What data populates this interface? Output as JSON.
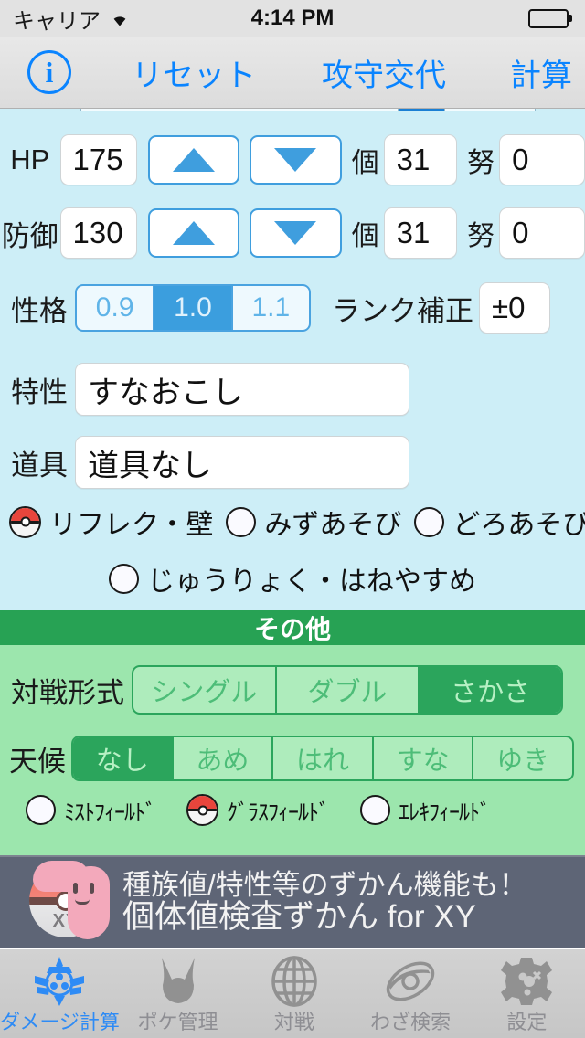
{
  "status_bar": {
    "carrier": "キャリア",
    "wifi_icon": "wifi-icon",
    "time": "4:14 PM",
    "battery_icon": "battery-full-icon"
  },
  "nav_bar": {
    "info_icon": "i",
    "reset_label": "リセット",
    "swap_label": "攻守交代",
    "calc_label": "計算"
  },
  "defender": {
    "hp": {
      "label": "HP",
      "value": "175",
      "up_icon": "triangle-up-icon",
      "down_icon": "triangle-down-icon",
      "iv_label": "個",
      "iv_value": "31",
      "ev_label": "努",
      "ev_value": "0"
    },
    "defense": {
      "label": "防御",
      "value": "130",
      "up_icon": "triangle-up-icon",
      "down_icon": "triangle-down-icon",
      "iv_label": "個",
      "iv_value": "31",
      "ev_label": "努",
      "ev_value": "0"
    },
    "nature": {
      "label": "性格",
      "options": [
        "0.9",
        "1.0",
        "1.1"
      ],
      "selected_index": 1
    },
    "rank": {
      "label": "ランク補正",
      "value": "±0"
    },
    "ability": {
      "label": "特性",
      "value": "すなおこし"
    },
    "item": {
      "label": "道具",
      "value": "道具なし"
    },
    "toggles_row1": [
      {
        "label": "リフレク・壁",
        "checked": true
      },
      {
        "label": "みずあそび",
        "checked": false
      },
      {
        "label": "どろあそび",
        "checked": false
      }
    ],
    "toggles_row2": [
      {
        "label": "じゅうりょく・はねやすめ",
        "checked": false
      }
    ]
  },
  "other": {
    "header": "その他",
    "battle_format": {
      "label": "対戦形式",
      "options": [
        "シングル",
        "ダブル",
        "さかさ"
      ],
      "selected_index": 2
    },
    "weather": {
      "label": "天候",
      "options": [
        "なし",
        "あめ",
        "はれ",
        "すな",
        "ゆき"
      ],
      "selected_index": 0
    },
    "fields": [
      {
        "label": "ﾐｽﾄﾌｨｰﾙﾄﾞ",
        "checked": false
      },
      {
        "label": "ｸﾞﾗｽﾌｨｰﾙﾄﾞ",
        "checked": true
      },
      {
        "label": "ｴﾚｷﾌｨｰﾙﾄﾞ",
        "checked": false
      }
    ]
  },
  "ad": {
    "icon": "ditto-pokeball-xy-icon",
    "badge": "XY",
    "line1": "種族値/特性等のずかん機能も！",
    "line2": "個体値検査ずかん for XY"
  },
  "tab_bar": {
    "items": [
      {
        "label": "ダメージ計算",
        "icon": "damage-calc-icon",
        "active": true
      },
      {
        "label": "ポケ管理",
        "icon": "pokemon-head-icon",
        "active": false
      },
      {
        "label": "対戦",
        "icon": "globe-icon",
        "active": false
      },
      {
        "label": "わざ検索",
        "icon": "disc-icon",
        "active": false
      },
      {
        "label": "設定",
        "icon": "gear-icon",
        "active": false
      }
    ]
  },
  "colors": {
    "accent_blue": "#0a84ff",
    "section_blue_bg": "#cdeef7",
    "green_header": "#27a254",
    "green_bg": "#9ce6ad",
    "ad_bg": "#5e6576"
  }
}
